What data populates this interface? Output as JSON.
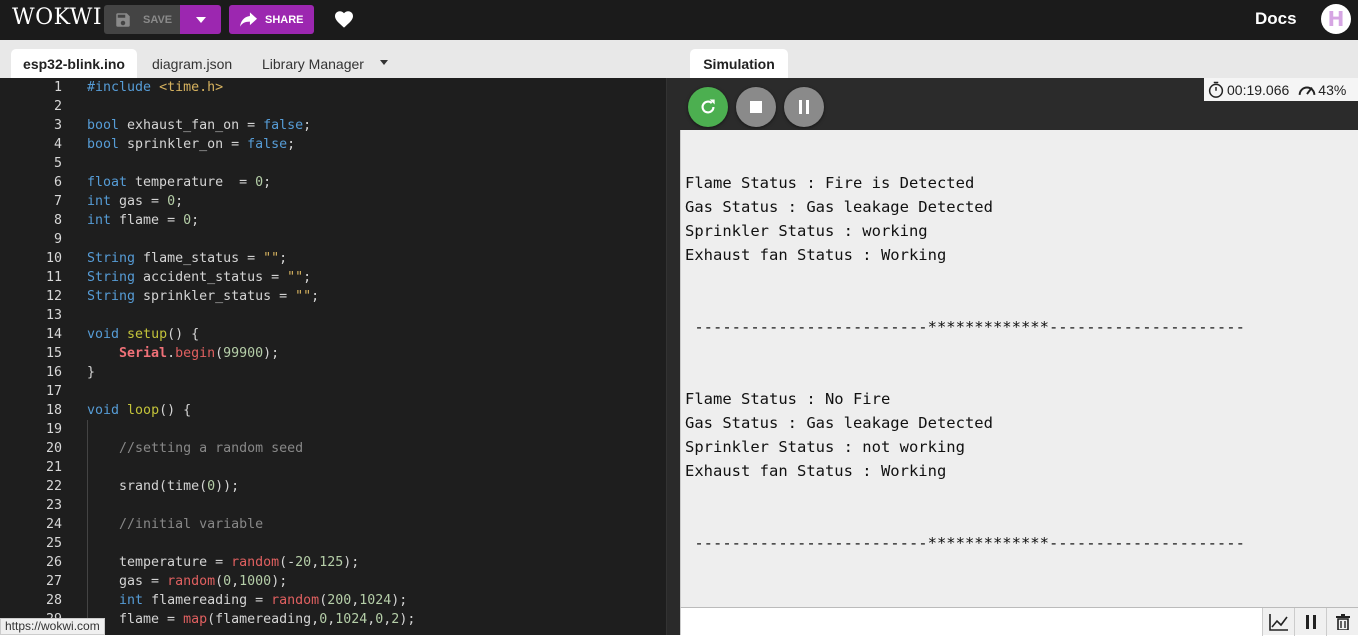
{
  "header": {
    "logo": "WOKWI",
    "save_label": "SAVE",
    "share_label": "SHARE",
    "docs_label": "Docs",
    "avatar_initial": "H"
  },
  "editor": {
    "tabs": [
      "esp32-blink.ino",
      "diagram.json",
      "Library Manager"
    ],
    "active_tab": "esp32-blink.ino",
    "lines": [
      "#include <time.h>",
      "",
      "bool exhaust_fan_on = false;",
      "bool sprinkler_on = false;",
      "",
      "float temperature  = 0;",
      "int gas = 0;",
      "int flame = 0;",
      "",
      "String flame_status = \"\";",
      "String accident_status = \"\";",
      "String sprinkler_status = \"\";",
      "",
      "void setup() {",
      "    Serial.begin(99900);",
      "}",
      "",
      "void loop() {",
      "",
      "    //setting a random seed",
      "",
      "    srand(time(0));",
      "",
      "    //initial variable",
      "",
      "    temperature = random(-20,125);",
      "    gas = random(0,1000);",
      "    int flamereading = random(200,1024);",
      "    flame = map(flamereading,0,1024,0,2);"
    ]
  },
  "status_url": "https://wokwi.com",
  "simulation": {
    "tab_label": "Simulation",
    "timer": "00:19.066",
    "speed": "43%",
    "serial_output": [
      "Flame Status : Fire is Detected",
      "Gas Status : Gas leakage Detected",
      "Sprinkler Status : working",
      "Exhaust fan Status : Working",
      "",
      "",
      " -------------------------*************---------------------",
      "",
      "",
      "Flame Status : No Fire",
      "Gas Status : Gas leakage Detected",
      "Sprinkler Status : not working",
      "Exhaust fan Status : Working",
      "",
      "",
      " -------------------------*************---------------------"
    ]
  },
  "colors": {
    "accent": "#9c27b0",
    "restart": "#4caf50",
    "editor_bg": "#1e1e1e"
  }
}
